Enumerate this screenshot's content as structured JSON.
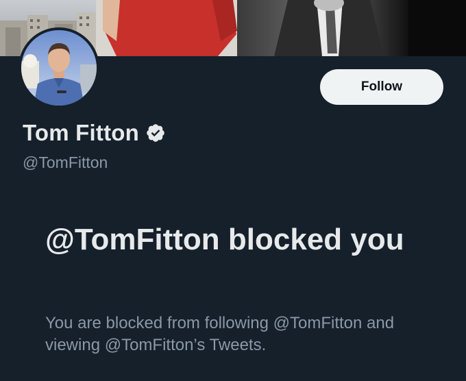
{
  "profile": {
    "display_name": "Tom Fitton",
    "handle": "@TomFitton",
    "verified": true,
    "follow_label": "Follow"
  },
  "blocked_notice": {
    "title": "@TomFitton blocked you",
    "description": "You are blocked from following @TomFitton and viewing @TomFitton’s Tweets."
  },
  "icons": {
    "verified": "verified-badge-icon"
  },
  "colors": {
    "background": "#15202b",
    "primary_text": "#e7e9ea",
    "secondary_text": "#8b98a5",
    "follow_button_bg": "#eff3f4",
    "follow_button_text": "#0f1419"
  }
}
